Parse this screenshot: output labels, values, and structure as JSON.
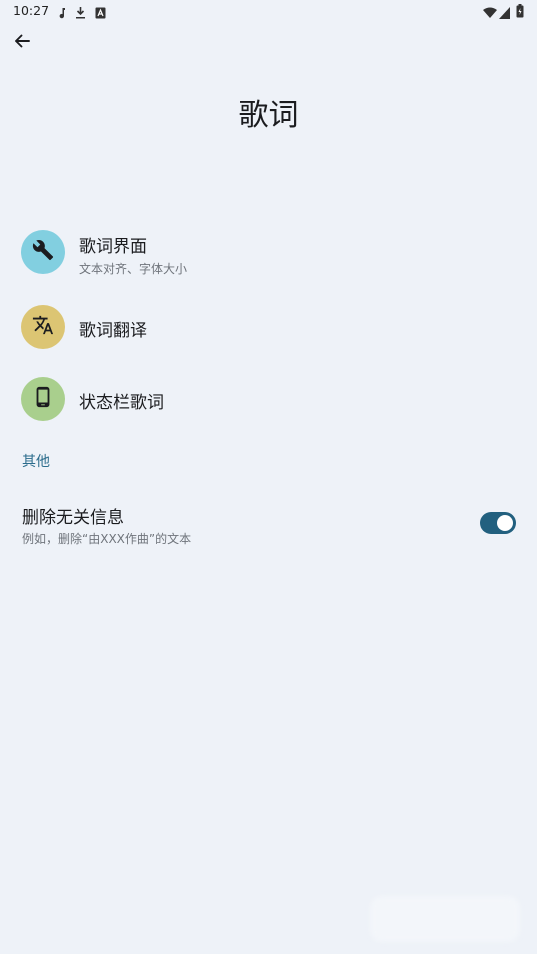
{
  "status_bar": {
    "time": "10:27",
    "icons": [
      "music-note-icon",
      "download-icon",
      "font-a-icon",
      "wifi-icon",
      "signal-icon",
      "battery-icon"
    ]
  },
  "header": {
    "back_icon": "arrow-back-icon",
    "title": "歌词"
  },
  "items": [
    {
      "title": "歌词界面",
      "summary": "文本对齐、字体大小",
      "icon": "wrench-icon",
      "color": "#82cfe0"
    },
    {
      "title": "歌词翻译",
      "summary": "",
      "icon": "translate-icon",
      "color": "#dcc573"
    },
    {
      "title": "状态栏歌词",
      "summary": "",
      "icon": "smartphone-icon",
      "color": "#a9cf8d"
    }
  ],
  "section": {
    "title": "其他"
  },
  "switch_item": {
    "title": "删除无关信息",
    "summary": "例如，删除“由XXX作曲”的文本",
    "checked": true,
    "color": "#22607f"
  }
}
